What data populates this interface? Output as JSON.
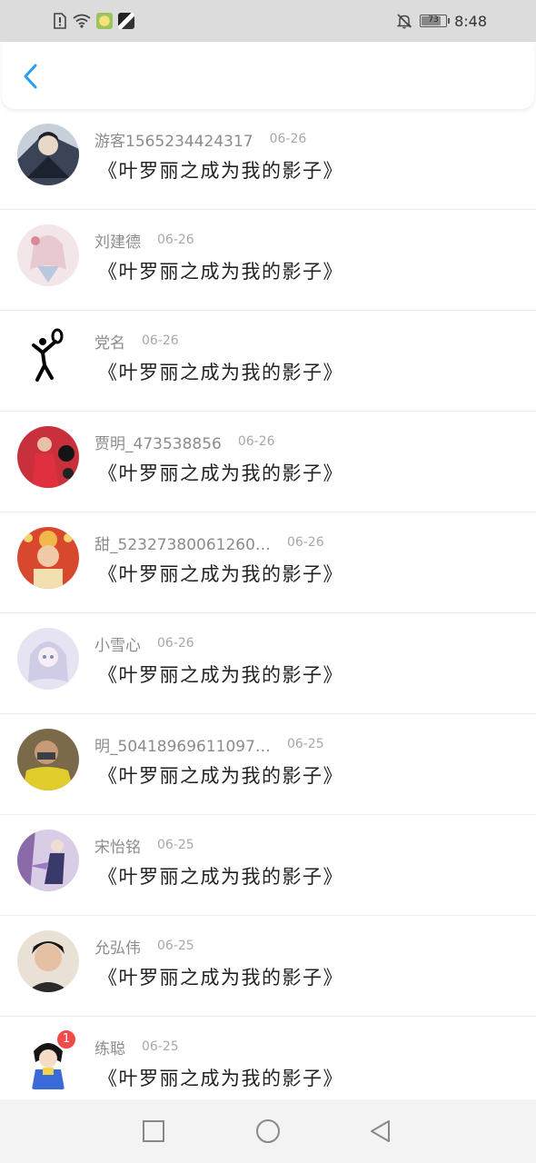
{
  "status_bar": {
    "time": "8:48",
    "battery": "73",
    "left_icons": [
      "alert-icon",
      "wifi-icon",
      "app-avatar-1",
      "app-avatar-2"
    ],
    "right_icons": [
      "bell-off-icon",
      "battery-icon"
    ]
  },
  "header": {
    "back_icon": "chevron-left-icon",
    "accent_color": "#2a9df4"
  },
  "list": {
    "items": [
      {
        "name": "游客1565234424317",
        "date": "06-26",
        "title": "《叶罗丽之成为我的影子》",
        "avatar_color": "#3b4456",
        "badge": null
      },
      {
        "name": "刘建德",
        "date": "06-26",
        "title": "《叶罗丽之成为我的影子》",
        "avatar_color": "#e8c9cf",
        "badge": null
      },
      {
        "name": "党名",
        "date": "06-26",
        "title": "《叶罗丽之成为我的影子》",
        "avatar_color": "#ffffff",
        "badge": null
      },
      {
        "name": "贾明_473538856",
        "date": "06-26",
        "title": "《叶罗丽之成为我的影子》",
        "avatar_color": "#c8303c",
        "badge": null
      },
      {
        "name": "甜_52327380061260…",
        "date": "06-26",
        "title": "《叶罗丽之成为我的影子》",
        "avatar_color": "#d8482e",
        "badge": null
      },
      {
        "name": "小雪心",
        "date": "06-26",
        "title": "《叶罗丽之成为我的影子》",
        "avatar_color": "#cfcde6",
        "badge": null
      },
      {
        "name": "明_50418969611097…",
        "date": "06-25",
        "title": "《叶罗丽之成为我的影子》",
        "avatar_color": "#e0cc2a",
        "badge": null
      },
      {
        "name": "宋怡铭",
        "date": "06-25",
        "title": "《叶罗丽之成为我的影子》",
        "avatar_color": "#8a6aa8",
        "badge": null
      },
      {
        "name": "允弘伟",
        "date": "06-25",
        "title": "《叶罗丽之成为我的影子》",
        "avatar_color": "#e9e1d6",
        "badge": null
      },
      {
        "name": "练聪",
        "date": "06-25",
        "title": "《叶罗丽之成为我的影子》",
        "avatar_color": "#ffffff",
        "badge": "1"
      }
    ]
  },
  "nav_bar": {
    "buttons": [
      "recent-apps-icon",
      "home-icon",
      "back-triangle-icon"
    ]
  }
}
